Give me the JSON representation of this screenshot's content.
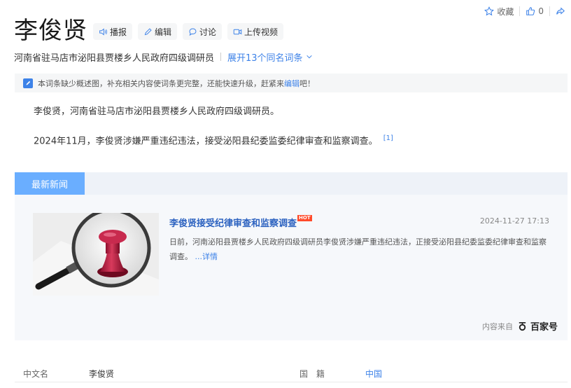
{
  "toolbar": {
    "favorite_label": "收藏",
    "like_count": "0"
  },
  "entry": {
    "title": "李俊贤",
    "actions": [
      {
        "icon": "speaker-icon",
        "label": "播报"
      },
      {
        "icon": "pencil-icon",
        "label": "编辑"
      },
      {
        "icon": "chat-icon",
        "label": "讨论"
      },
      {
        "icon": "video-icon",
        "label": "上传视频"
      }
    ],
    "subtitle": "河南省驻马店市泌阳县贾楼乡人民政府四级调研员",
    "same_name_link": "展开13个同名词条"
  },
  "notice": {
    "text_before": "本词条缺少概述图，补充相关内容使词条更完整，还能快速升级，赶紧来",
    "link": "编辑",
    "text_after": "吧！"
  },
  "content": {
    "paragraph1": "李俊贤，河南省驻马店市泌阳县贾楼乡人民政府四级调研员。",
    "paragraph2": "2024年11月，李俊贤涉嫌严重违纪违法，接受泌阳县纪委监委纪律审查和监察调查。",
    "ref": "[1]"
  },
  "news": {
    "tab_label": "最新新闻",
    "headline": "李俊贤接受纪律审查和监察调查",
    "hot_badge": "HOT",
    "time": "2024-11-27 17:13",
    "summary": "日前，河南泌阳县贾楼乡人民政府四级调研员李俊贤涉嫌严重违纪违法，正接受泌阳县纪委监委纪律审查和监察调查。",
    "more": "...详情",
    "source_prefix": "内容来自",
    "source_brand": "百家号"
  },
  "infobox": {
    "row1": {
      "label1": "中文名",
      "value1": "李俊贤",
      "label2": "国　籍",
      "value2": "中国"
    }
  },
  "colors": {
    "accent": "#3d82e8",
    "tab": "#6aaeff",
    "hot": "#ff4b2b"
  }
}
